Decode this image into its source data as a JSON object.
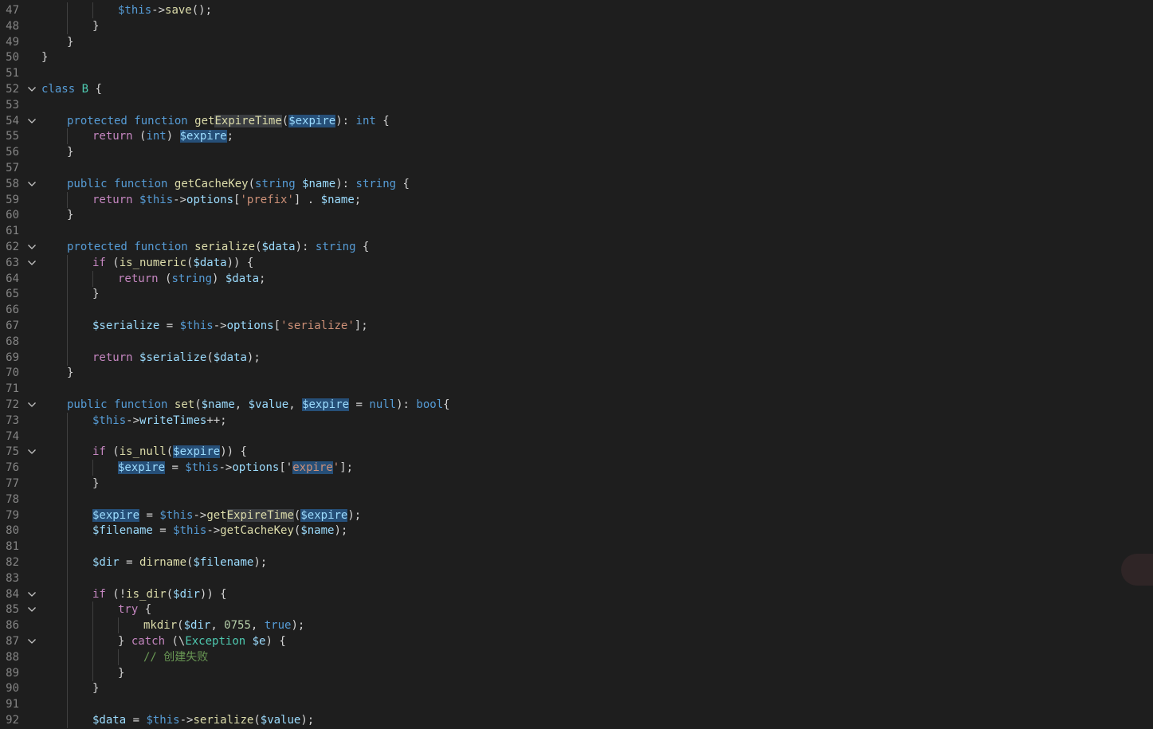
{
  "editor": {
    "lines": [
      {
        "n": "47",
        "fold": false,
        "indent": 3,
        "tokens": [
          [
            "$this",
            "kw"
          ],
          [
            "->",
            ""
          ],
          [
            "save",
            "fn"
          ],
          [
            "();",
            ""
          ]
        ]
      },
      {
        "n": "48",
        "fold": false,
        "indent": 2,
        "tokens": [
          [
            "}",
            ""
          ]
        ]
      },
      {
        "n": "49",
        "fold": false,
        "indent": 1,
        "tokens": [
          [
            "}",
            ""
          ]
        ]
      },
      {
        "n": "50",
        "fold": false,
        "indent": 0,
        "tokens": [
          [
            "}",
            ""
          ]
        ]
      },
      {
        "n": "51",
        "fold": false,
        "indent": 0,
        "tokens": []
      },
      {
        "n": "52",
        "fold": true,
        "indent": 0,
        "tokens": [
          [
            "class",
            "kw"
          ],
          [
            " ",
            ""
          ],
          [
            "B",
            "cls"
          ],
          [
            " {",
            ""
          ]
        ]
      },
      {
        "n": "53",
        "fold": false,
        "indent": 0,
        "tokens": []
      },
      {
        "n": "54",
        "fold": true,
        "indent": 1,
        "tokens": [
          [
            "protected",
            "kw"
          ],
          [
            " ",
            ""
          ],
          [
            "function",
            "kw"
          ],
          [
            " ",
            ""
          ],
          [
            "get",
            "fn"
          ],
          [
            "ExpireTime",
            "fn hl2"
          ],
          [
            "(",
            ""
          ],
          [
            "$expire",
            "var hl"
          ],
          [
            "): ",
            ""
          ],
          [
            "int",
            "kw"
          ],
          [
            " {",
            ""
          ]
        ]
      },
      {
        "n": "55",
        "fold": false,
        "indent": 2,
        "tokens": [
          [
            "return",
            "ctl"
          ],
          [
            " (",
            ""
          ],
          [
            "int",
            "kw"
          ],
          [
            ") ",
            ""
          ],
          [
            "$expire",
            "var hl"
          ],
          [
            ";",
            ""
          ]
        ]
      },
      {
        "n": "56",
        "fold": false,
        "indent": 1,
        "tokens": [
          [
            "}",
            ""
          ]
        ]
      },
      {
        "n": "57",
        "fold": false,
        "indent": 0,
        "tokens": []
      },
      {
        "n": "58",
        "fold": true,
        "indent": 1,
        "tokens": [
          [
            "public",
            "kw"
          ],
          [
            " ",
            ""
          ],
          [
            "function",
            "kw"
          ],
          [
            " ",
            ""
          ],
          [
            "getCacheKey",
            "fn"
          ],
          [
            "(",
            ""
          ],
          [
            "string",
            "kw"
          ],
          [
            " ",
            ""
          ],
          [
            "$name",
            "var"
          ],
          [
            "): ",
            ""
          ],
          [
            "string",
            "kw"
          ],
          [
            " {",
            ""
          ]
        ]
      },
      {
        "n": "59",
        "fold": false,
        "indent": 2,
        "tokens": [
          [
            "return",
            "ctl"
          ],
          [
            " ",
            ""
          ],
          [
            "$this",
            "kw"
          ],
          [
            "->",
            ""
          ],
          [
            "options",
            "var"
          ],
          [
            "[",
            ""
          ],
          [
            "'prefix'",
            "str"
          ],
          [
            "] . ",
            ""
          ],
          [
            "$name",
            "var"
          ],
          [
            ";",
            ""
          ]
        ]
      },
      {
        "n": "60",
        "fold": false,
        "indent": 1,
        "tokens": [
          [
            "}",
            ""
          ]
        ]
      },
      {
        "n": "61",
        "fold": false,
        "indent": 0,
        "tokens": []
      },
      {
        "n": "62",
        "fold": true,
        "indent": 1,
        "tokens": [
          [
            "protected",
            "kw"
          ],
          [
            " ",
            ""
          ],
          [
            "function",
            "kw"
          ],
          [
            " ",
            ""
          ],
          [
            "serialize",
            "fn"
          ],
          [
            "(",
            ""
          ],
          [
            "$data",
            "var"
          ],
          [
            "): ",
            ""
          ],
          [
            "string",
            "kw"
          ],
          [
            " {",
            ""
          ]
        ]
      },
      {
        "n": "63",
        "fold": true,
        "indent": 2,
        "tokens": [
          [
            "if",
            "ctl"
          ],
          [
            " (",
            ""
          ],
          [
            "is_numeric",
            "fn"
          ],
          [
            "(",
            ""
          ],
          [
            "$data",
            "var"
          ],
          [
            ")) {",
            ""
          ]
        ]
      },
      {
        "n": "64",
        "fold": false,
        "indent": 3,
        "tokens": [
          [
            "return",
            "ctl"
          ],
          [
            " (",
            ""
          ],
          [
            "string",
            "kw"
          ],
          [
            ") ",
            ""
          ],
          [
            "$data",
            "var"
          ],
          [
            ";",
            ""
          ]
        ]
      },
      {
        "n": "65",
        "fold": false,
        "indent": 2,
        "tokens": [
          [
            "}",
            ""
          ]
        ]
      },
      {
        "n": "66",
        "fold": false,
        "indent": 0,
        "tokens": []
      },
      {
        "n": "67",
        "fold": false,
        "indent": 2,
        "tokens": [
          [
            "$serialize",
            "var"
          ],
          [
            " = ",
            ""
          ],
          [
            "$this",
            "kw"
          ],
          [
            "->",
            ""
          ],
          [
            "options",
            "var"
          ],
          [
            "[",
            ""
          ],
          [
            "'serialize'",
            "str"
          ],
          [
            "];",
            ""
          ]
        ]
      },
      {
        "n": "68",
        "fold": false,
        "indent": 0,
        "tokens": []
      },
      {
        "n": "69",
        "fold": false,
        "indent": 2,
        "tokens": [
          [
            "return",
            "ctl"
          ],
          [
            " ",
            ""
          ],
          [
            "$serialize",
            "var"
          ],
          [
            "(",
            ""
          ],
          [
            "$data",
            "var"
          ],
          [
            ");",
            ""
          ]
        ]
      },
      {
        "n": "70",
        "fold": false,
        "indent": 1,
        "tokens": [
          [
            "}",
            ""
          ]
        ]
      },
      {
        "n": "71",
        "fold": false,
        "indent": 0,
        "tokens": []
      },
      {
        "n": "72",
        "fold": true,
        "indent": 1,
        "tokens": [
          [
            "public",
            "kw"
          ],
          [
            " ",
            ""
          ],
          [
            "function",
            "kw"
          ],
          [
            " ",
            ""
          ],
          [
            "set",
            "fn"
          ],
          [
            "(",
            ""
          ],
          [
            "$name",
            "var"
          ],
          [
            ", ",
            ""
          ],
          [
            "$value",
            "var"
          ],
          [
            ", ",
            ""
          ],
          [
            "$expire",
            "var hl"
          ],
          [
            " = ",
            ""
          ],
          [
            "null",
            "kw"
          ],
          [
            "): ",
            ""
          ],
          [
            "bool",
            "kw"
          ],
          [
            "{",
            ""
          ]
        ]
      },
      {
        "n": "73",
        "fold": false,
        "indent": 2,
        "tokens": [
          [
            "$this",
            "kw"
          ],
          [
            "->",
            ""
          ],
          [
            "writeTimes",
            "var"
          ],
          [
            "++;",
            ""
          ]
        ]
      },
      {
        "n": "74",
        "fold": false,
        "indent": 0,
        "tokens": []
      },
      {
        "n": "75",
        "fold": true,
        "indent": 2,
        "tokens": [
          [
            "if",
            "ctl"
          ],
          [
            " (",
            ""
          ],
          [
            "is_null",
            "fn"
          ],
          [
            "(",
            ""
          ],
          [
            "$expire",
            "var hl"
          ],
          [
            ")) {",
            ""
          ]
        ]
      },
      {
        "n": "76",
        "fold": false,
        "indent": 3,
        "tokens": [
          [
            "$expire",
            "var hl"
          ],
          [
            " = ",
            ""
          ],
          [
            "$this",
            "kw"
          ],
          [
            "->",
            ""
          ],
          [
            "options",
            "var"
          ],
          [
            "[",
            ""
          ],
          [
            "'",
            ""
          ],
          [
            "expire",
            "str hl"
          ],
          [
            "'",
            "str"
          ],
          [
            "];",
            ""
          ]
        ]
      },
      {
        "n": "77",
        "fold": false,
        "indent": 2,
        "tokens": [
          [
            "}",
            ""
          ]
        ]
      },
      {
        "n": "78",
        "fold": false,
        "indent": 0,
        "tokens": []
      },
      {
        "n": "79",
        "fold": false,
        "indent": 2,
        "tokens": [
          [
            "$expire",
            "var hl"
          ],
          [
            " = ",
            ""
          ],
          [
            "$this",
            "kw"
          ],
          [
            "->",
            ""
          ],
          [
            "get",
            "fn"
          ],
          [
            "ExpireTime",
            "fn hl2"
          ],
          [
            "(",
            ""
          ],
          [
            "$expire",
            "var hl"
          ],
          [
            ");",
            ""
          ]
        ]
      },
      {
        "n": "80",
        "fold": false,
        "indent": 2,
        "tokens": [
          [
            "$filename",
            "var"
          ],
          [
            " = ",
            ""
          ],
          [
            "$this",
            "kw"
          ],
          [
            "->",
            ""
          ],
          [
            "getCacheKey",
            "fn"
          ],
          [
            "(",
            ""
          ],
          [
            "$name",
            "var"
          ],
          [
            ");",
            ""
          ]
        ]
      },
      {
        "n": "81",
        "fold": false,
        "indent": 0,
        "tokens": []
      },
      {
        "n": "82",
        "fold": false,
        "indent": 2,
        "tokens": [
          [
            "$dir",
            "var"
          ],
          [
            " = ",
            ""
          ],
          [
            "dirname",
            "fn"
          ],
          [
            "(",
            ""
          ],
          [
            "$filename",
            "var"
          ],
          [
            ");",
            ""
          ]
        ]
      },
      {
        "n": "83",
        "fold": false,
        "indent": 0,
        "tokens": []
      },
      {
        "n": "84",
        "fold": true,
        "indent": 2,
        "tokens": [
          [
            "if",
            "ctl"
          ],
          [
            " (!",
            ""
          ],
          [
            "is_dir",
            "fn"
          ],
          [
            "(",
            ""
          ],
          [
            "$dir",
            "var"
          ],
          [
            ")) {",
            ""
          ]
        ]
      },
      {
        "n": "85",
        "fold": true,
        "indent": 3,
        "tokens": [
          [
            "try",
            "ctl"
          ],
          [
            " {",
            ""
          ]
        ]
      },
      {
        "n": "86",
        "fold": false,
        "indent": 4,
        "tokens": [
          [
            "mkdir",
            "fn"
          ],
          [
            "(",
            ""
          ],
          [
            "$dir",
            "var"
          ],
          [
            ", ",
            ""
          ],
          [
            "0755",
            "num"
          ],
          [
            ", ",
            ""
          ],
          [
            "true",
            "kw"
          ],
          [
            ");",
            ""
          ]
        ]
      },
      {
        "n": "87",
        "fold": true,
        "indent": 3,
        "tokens": [
          [
            "} ",
            ""
          ],
          [
            "catch",
            "ctl"
          ],
          [
            " (\\",
            ""
          ],
          [
            "Exception",
            "cls"
          ],
          [
            " ",
            ""
          ],
          [
            "$e",
            "var"
          ],
          [
            ") {",
            ""
          ]
        ]
      },
      {
        "n": "88",
        "fold": false,
        "indent": 4,
        "tokens": [
          [
            "// 创建失败",
            "cmt"
          ]
        ]
      },
      {
        "n": "89",
        "fold": false,
        "indent": 3,
        "tokens": [
          [
            "}",
            ""
          ]
        ]
      },
      {
        "n": "90",
        "fold": false,
        "indent": 2,
        "tokens": [
          [
            "}",
            ""
          ]
        ]
      },
      {
        "n": "91",
        "fold": false,
        "indent": 0,
        "tokens": []
      },
      {
        "n": "92",
        "fold": false,
        "indent": 2,
        "tokens": [
          [
            "$data",
            "var"
          ],
          [
            " = ",
            ""
          ],
          [
            "$this",
            "kw"
          ],
          [
            "->",
            ""
          ],
          [
            "serialize",
            "fn"
          ],
          [
            "(",
            ""
          ],
          [
            "$value",
            "var"
          ],
          [
            ");",
            ""
          ]
        ]
      }
    ],
    "guides": {
      "47": [
        1,
        2
      ],
      "48": [
        1
      ],
      "49": [],
      "50": [],
      "51": [],
      "52": [],
      "53": [],
      "54": [],
      "55": [
        1
      ],
      "56": [],
      "57": [],
      "58": [],
      "59": [
        1
      ],
      "60": [],
      "61": [],
      "62": [],
      "63": [
        1
      ],
      "64": [
        1,
        2
      ],
      "65": [
        1
      ],
      "66": [
        1
      ],
      "67": [
        1
      ],
      "68": [
        1
      ],
      "69": [
        1
      ],
      "70": [],
      "71": [],
      "72": [],
      "73": [
        1
      ],
      "74": [
        1
      ],
      "75": [
        1
      ],
      "76": [
        1,
        2
      ],
      "77": [
        1
      ],
      "78": [
        1
      ],
      "79": [
        1
      ],
      "80": [
        1
      ],
      "81": [
        1
      ],
      "82": [
        1
      ],
      "83": [
        1
      ],
      "84": [
        1
      ],
      "85": [
        1,
        2
      ],
      "86": [
        1,
        2,
        3
      ],
      "87": [
        1,
        2
      ],
      "88": [
        1,
        2,
        3
      ],
      "89": [
        1,
        2
      ],
      "90": [
        1
      ],
      "91": [
        1
      ],
      "92": [
        1
      ]
    }
  }
}
